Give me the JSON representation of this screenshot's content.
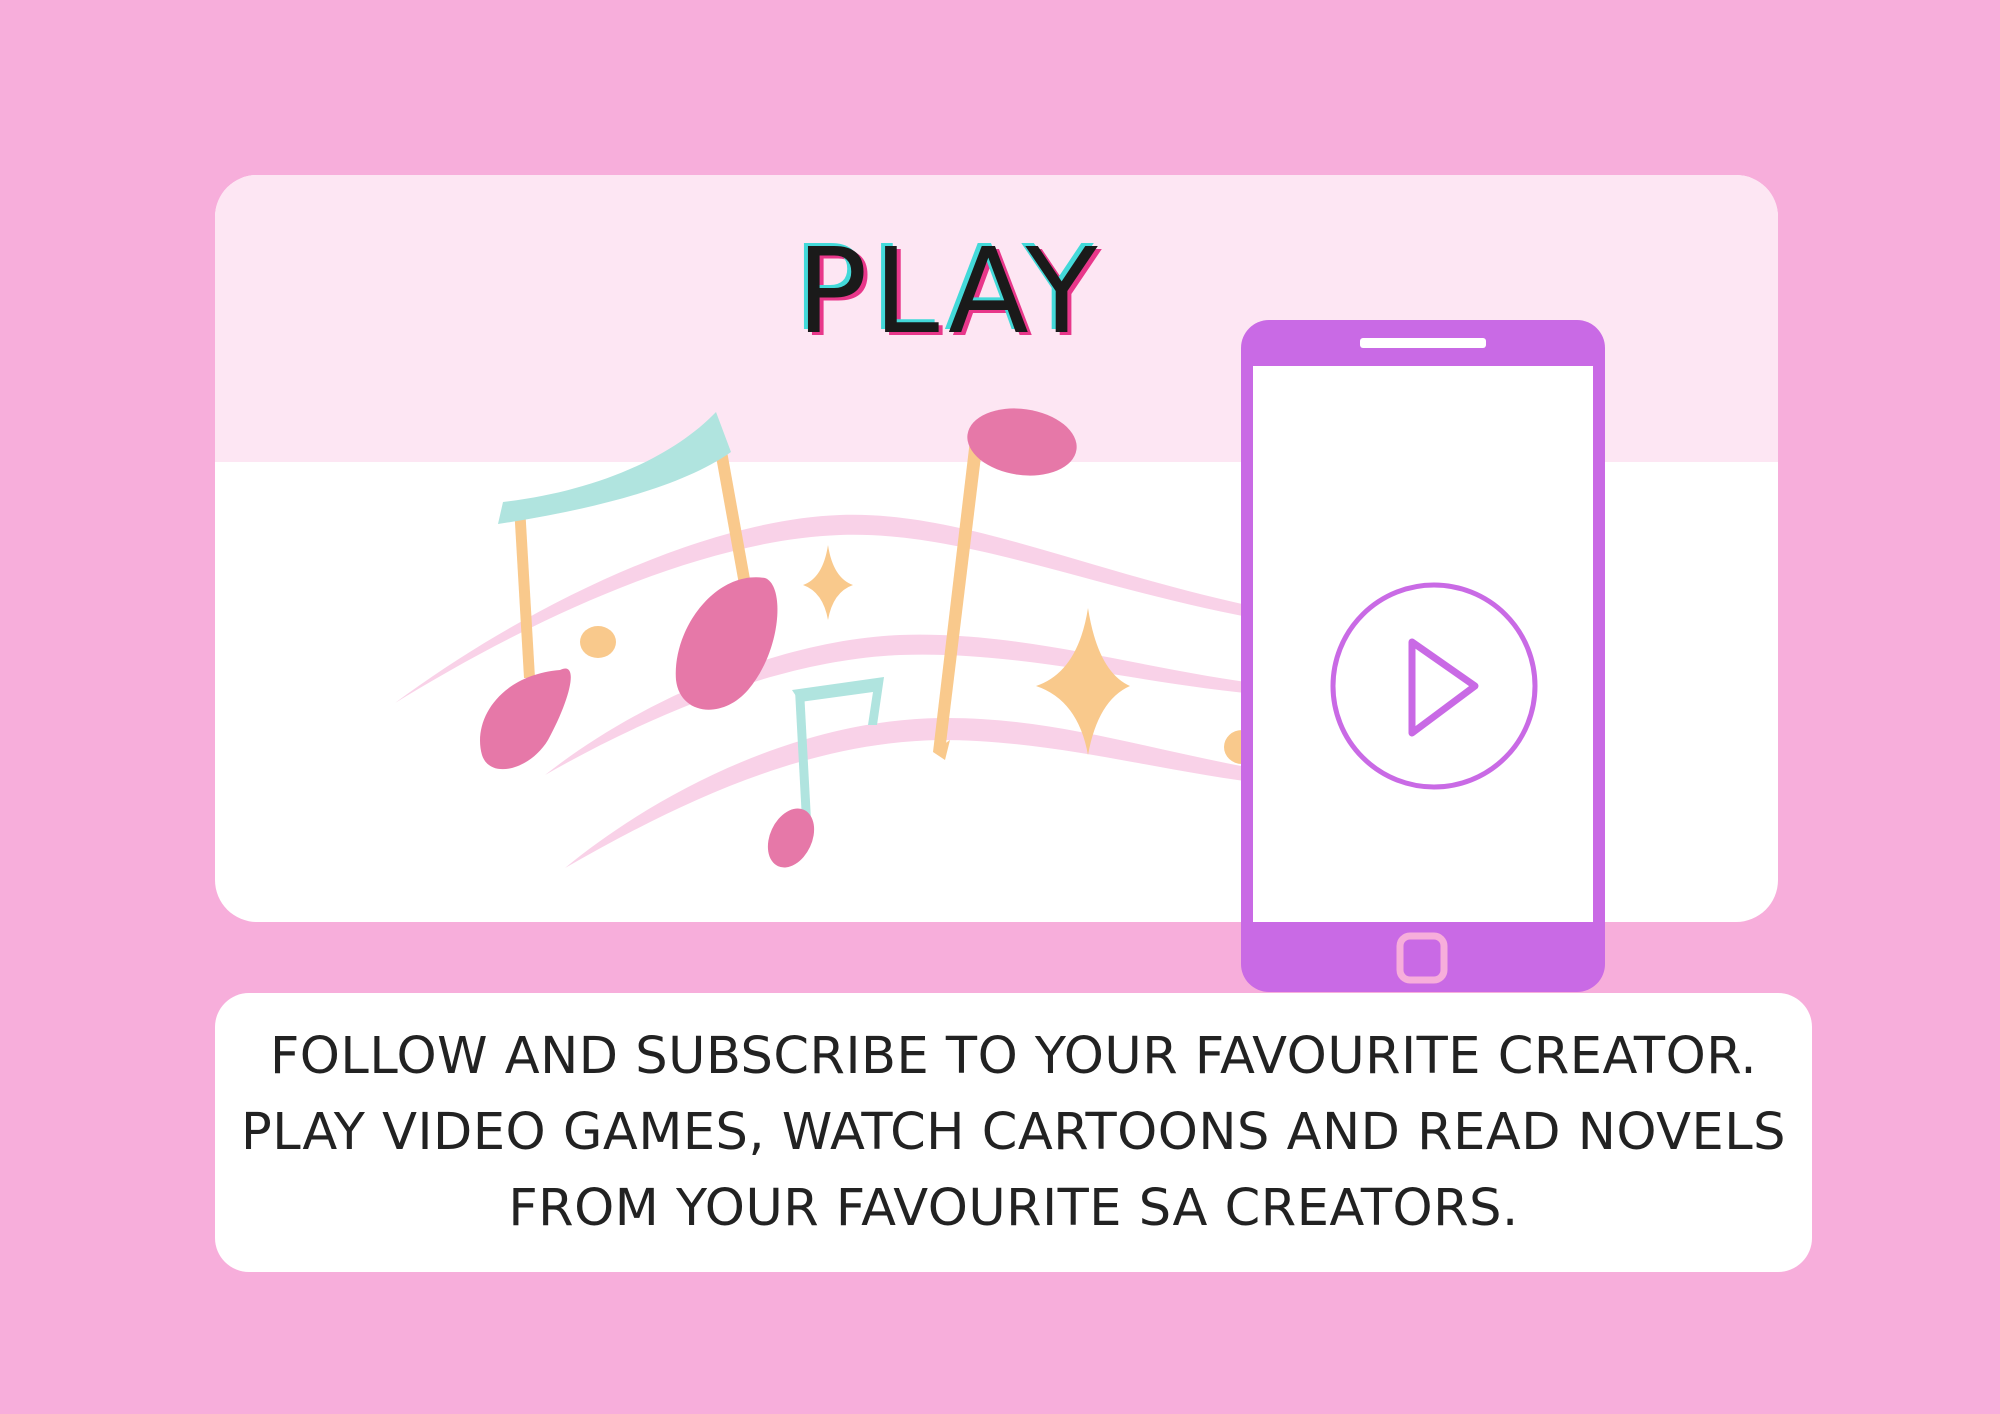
{
  "poster": {
    "title": "PLAY",
    "description_lines": [
      "FOLLOW AND SUBSCRIBE TO YOUR FAVOURITE CREATOR.",
      "PLAY VIDEO GAMES, WATCH CARTOONS AND READ NOVELS",
      "FROM YOUR FAVOURITE SA CREATORS."
    ]
  },
  "colors": {
    "background": "#f7aedb",
    "card_top": "#fde6f3",
    "phone": "#c96ae5",
    "note_pink": "#e678a8",
    "note_teal": "#b0e4df",
    "note_orange": "#f9c98c",
    "staff_pink": "#f9d2e8"
  },
  "icons": [
    "music-notes-icon",
    "sparkle-icon",
    "smartphone-icon",
    "play-icon"
  ]
}
